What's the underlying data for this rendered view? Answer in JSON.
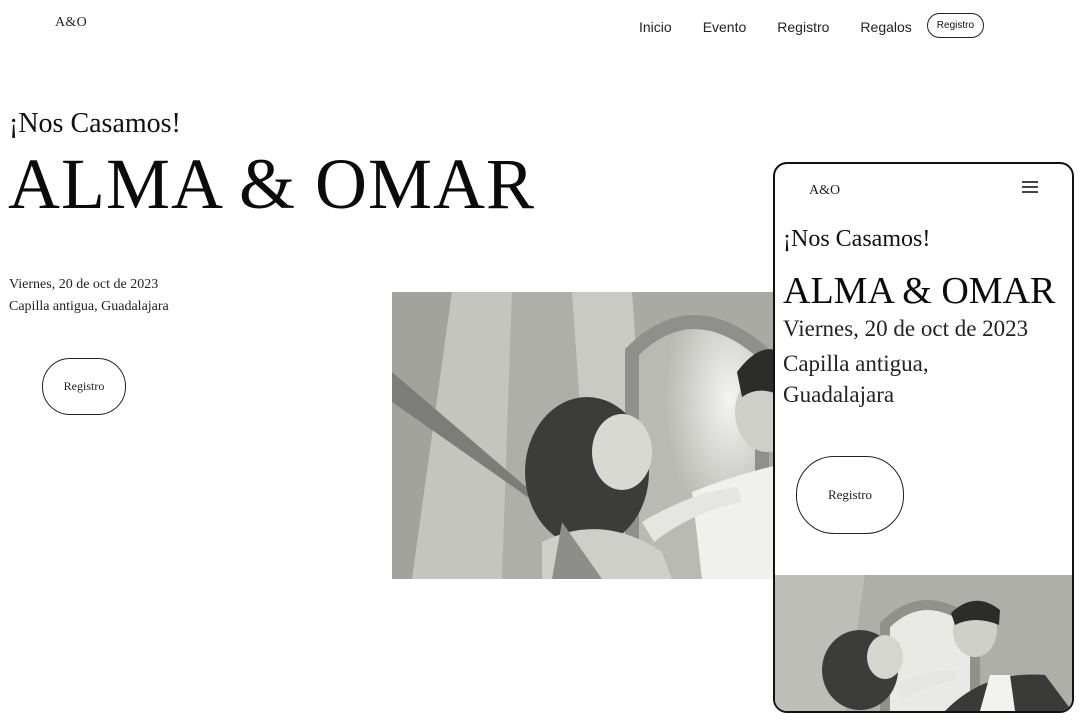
{
  "header": {
    "logo": "A&O",
    "nav": [
      "Inicio",
      "Evento",
      "Registro",
      "Regalos"
    ],
    "cta": "Registro"
  },
  "hero": {
    "pretitle": "¡Nos Casamos!",
    "names": "ALMA & OMAR",
    "date": "Viernes, 20 de oct de 2023",
    "place": "Capilla antigua, Guadalajara",
    "button": "Registro"
  },
  "mobile": {
    "logo": "A&O",
    "pretitle": "¡Nos Casamos!",
    "names": "ALMA & OMAR",
    "date": "Viernes, 20 de oct de 2023",
    "place": "Capilla antigua, Guadalajara",
    "button": "Registro",
    "menu_icon": "hamburger-menu-icon"
  },
  "colors": {
    "background": "#ffffff",
    "text": "#111111",
    "photo_tone": "#9a9c96"
  }
}
